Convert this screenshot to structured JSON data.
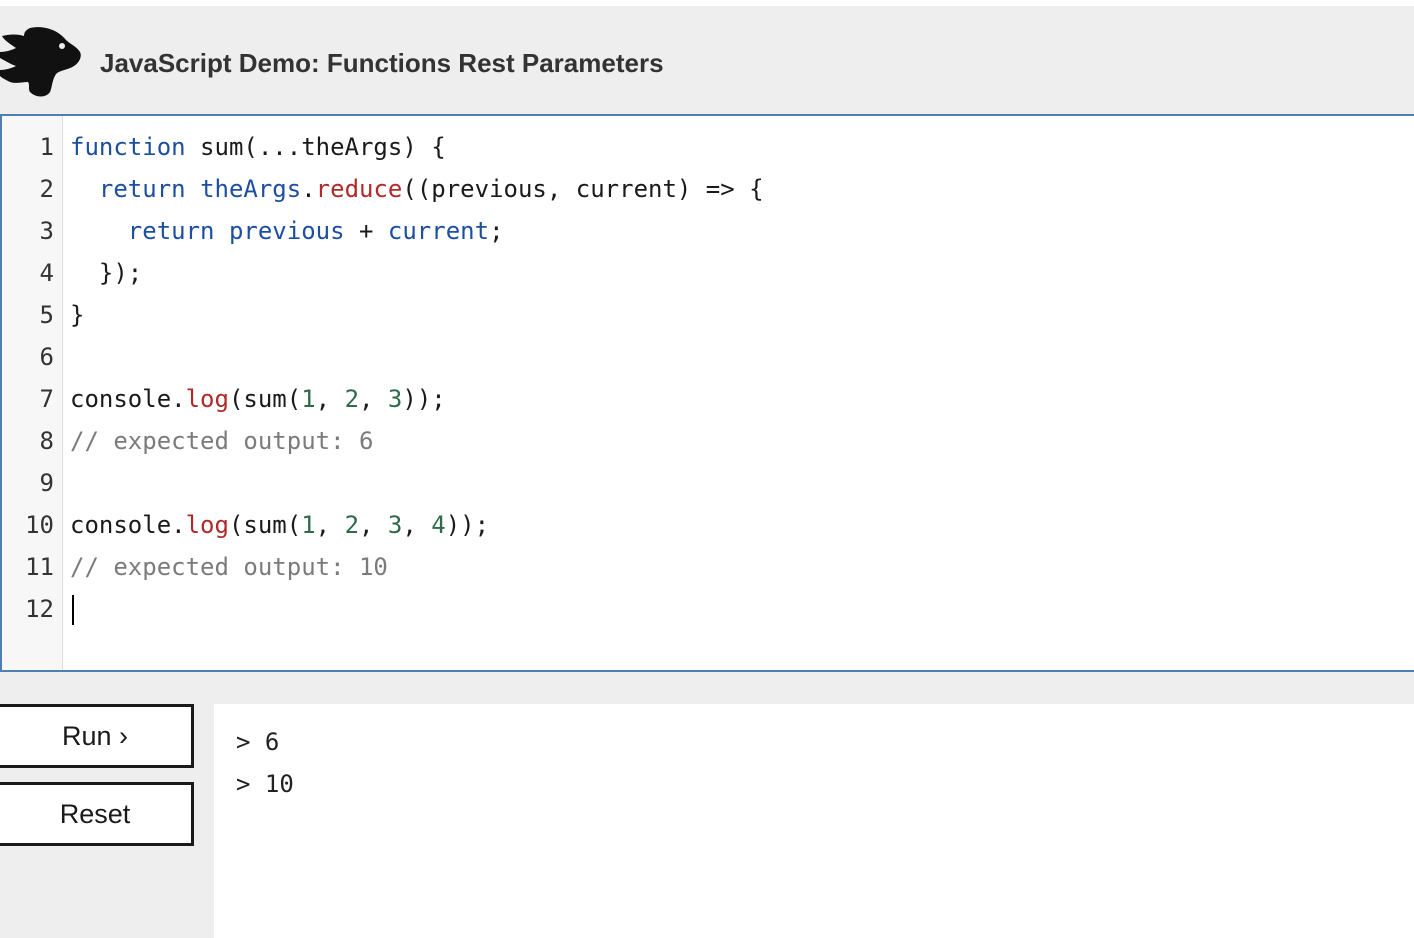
{
  "header": {
    "title": "JavaScript Demo: Functions Rest Parameters",
    "logo_icon": "dinosaur-logo-icon"
  },
  "editor": {
    "line_numbers": [
      "1",
      "2",
      "3",
      "4",
      "5",
      "6",
      "7",
      "8",
      "9",
      "10",
      "11",
      "12"
    ],
    "lines": [
      [
        {
          "t": "function",
          "c": "kw"
        },
        {
          "t": " sum(...theArgs) {",
          "c": ""
        }
      ],
      [
        {
          "t": "  ",
          "c": ""
        },
        {
          "t": "return",
          "c": "kw"
        },
        {
          "t": " ",
          "c": ""
        },
        {
          "t": "theArgs",
          "c": "var"
        },
        {
          "t": ".",
          "c": ""
        },
        {
          "t": "reduce",
          "c": "fn"
        },
        {
          "t": "((previous, current) => {",
          "c": ""
        }
      ],
      [
        {
          "t": "    ",
          "c": ""
        },
        {
          "t": "return",
          "c": "kw"
        },
        {
          "t": " ",
          "c": ""
        },
        {
          "t": "previous",
          "c": "var"
        },
        {
          "t": " + ",
          "c": ""
        },
        {
          "t": "current",
          "c": "var"
        },
        {
          "t": ";",
          "c": ""
        }
      ],
      [
        {
          "t": "  });",
          "c": ""
        }
      ],
      [
        {
          "t": "}",
          "c": ""
        }
      ],
      [],
      [
        {
          "t": "console.",
          "c": ""
        },
        {
          "t": "log",
          "c": "fn"
        },
        {
          "t": "(sum(",
          "c": ""
        },
        {
          "t": "1",
          "c": "num"
        },
        {
          "t": ", ",
          "c": ""
        },
        {
          "t": "2",
          "c": "num"
        },
        {
          "t": ", ",
          "c": ""
        },
        {
          "t": "3",
          "c": "num"
        },
        {
          "t": "));",
          "c": ""
        }
      ],
      [
        {
          "t": "// expected output: 6",
          "c": "com"
        }
      ],
      [],
      [
        {
          "t": "console.",
          "c": ""
        },
        {
          "t": "log",
          "c": "fn"
        },
        {
          "t": "(sum(",
          "c": ""
        },
        {
          "t": "1",
          "c": "num"
        },
        {
          "t": ", ",
          "c": ""
        },
        {
          "t": "2",
          "c": "num"
        },
        {
          "t": ", ",
          "c": ""
        },
        {
          "t": "3",
          "c": "num"
        },
        {
          "t": ", ",
          "c": ""
        },
        {
          "t": "4",
          "c": "num"
        },
        {
          "t": "));",
          "c": ""
        }
      ],
      [
        {
          "t": "// expected output: 10",
          "c": "com"
        }
      ],
      []
    ],
    "cursor_line": 12
  },
  "controls": {
    "run_label": "Run ›",
    "reset_label": "Reset"
  },
  "output": {
    "lines": [
      "> 6",
      "> 10"
    ]
  },
  "colors": {
    "keyword": "#1d4fa0",
    "function_call": "#b02a2a",
    "number": "#2f6a4a",
    "comment": "#7b7b7b",
    "editor_border": "#4f7fb1"
  }
}
